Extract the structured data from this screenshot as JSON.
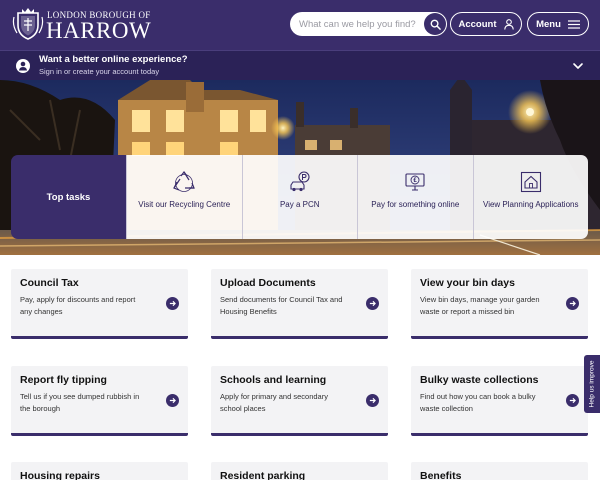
{
  "header": {
    "logo": {
      "top_line": "LONDON BOROUGH OF",
      "name": "HARROW"
    },
    "search": {
      "placeholder": "What can we help you find?"
    },
    "account_label": "Account",
    "menu_label": "Menu"
  },
  "signin": {
    "title": "Want a better online experience?",
    "subtitle": "Sign in or create your account today"
  },
  "top_tasks": {
    "label": "Top tasks",
    "items": [
      {
        "label": "Visit our Recycling Centre",
        "icon": "recycle-icon"
      },
      {
        "label": "Pay a PCN",
        "icon": "car-parking-icon"
      },
      {
        "label": "Pay for something online",
        "icon": "pound-monitor-icon"
      },
      {
        "label": "View Planning Applications",
        "icon": "house-plan-icon"
      }
    ]
  },
  "cards": [
    {
      "title": "Council Tax",
      "desc": "Pay, apply for discounts and report any changes"
    },
    {
      "title": "Upload Documents",
      "desc": "Send documents for Council Tax and Housing Benefits"
    },
    {
      "title": "View your bin days",
      "desc": "View bin days, manage your garden waste or report a missed bin"
    },
    {
      "title": "Report fly tipping",
      "desc": "Tell us if you see dumped rubbish in the borough"
    },
    {
      "title": "Schools and learning",
      "desc": "Apply for primary and secondary school places"
    },
    {
      "title": "Bulky waste collections",
      "desc": "Find out how you can book a bulky waste collection"
    },
    {
      "title": "Housing repairs",
      "desc": ""
    },
    {
      "title": "Resident parking",
      "desc": ""
    },
    {
      "title": "Benefits",
      "desc": ""
    }
  ],
  "feedback_label": "Help us improve",
  "colors": {
    "brand_purple": "#3a2d6b",
    "signin_bar": "#2b2257",
    "card_bg": "#f3f3f5"
  }
}
